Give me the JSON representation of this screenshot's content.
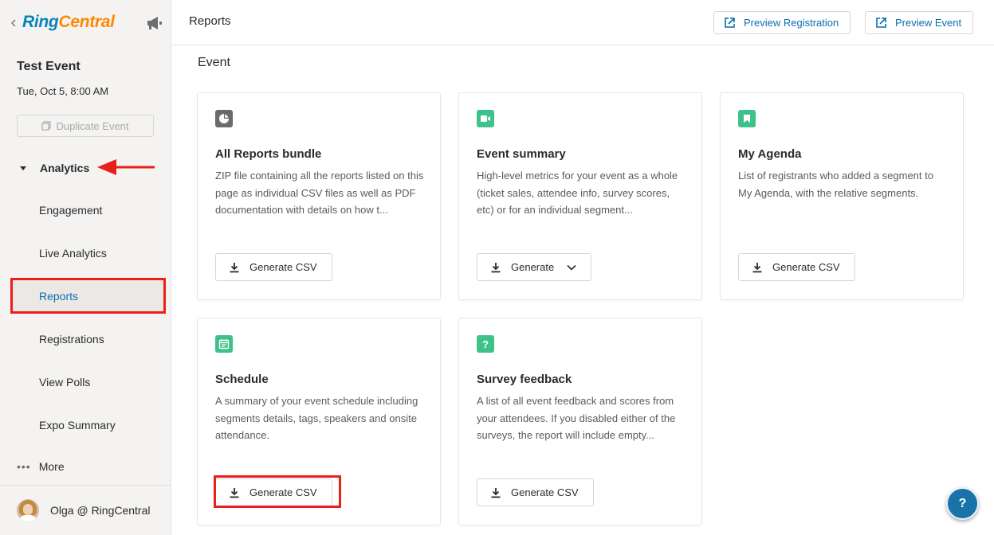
{
  "brand": {
    "name_part1": "Ring",
    "name_part2": "Central",
    "accent": "#0684bc",
    "accent2": "#ff8800"
  },
  "event": {
    "title": "Test Event",
    "date": "Tue, Oct 5, 8:00 AM",
    "duplicate_label": "Duplicate Event"
  },
  "nav": {
    "section_label": "Analytics",
    "items": [
      {
        "label": "Engagement",
        "active": false
      },
      {
        "label": "Live Analytics",
        "active": false
      },
      {
        "label": "Reports",
        "active": true
      },
      {
        "label": "Registrations",
        "active": false
      },
      {
        "label": "View Polls",
        "active": false
      },
      {
        "label": "Expo Summary",
        "active": false
      }
    ],
    "more_label": "More"
  },
  "user": {
    "name": "Olga @ RingCentral"
  },
  "header": {
    "title": "Reports",
    "preview_registration": "Preview Registration",
    "preview_event": "Preview Event"
  },
  "main": {
    "section_title": "Event",
    "cards": [
      {
        "title": "All Reports bundle",
        "desc": "ZIP file containing all the reports listed on this page as individual CSV files as well as PDF documentation with details on how t...",
        "button": "Generate CSV",
        "icon": "pie-chart-icon",
        "icon_color": "#6b6b6b"
      },
      {
        "title": "Event summary",
        "desc": "High-level metrics for your event as a whole (ticket sales, attendee info, survey scores, etc) or for an individual segment...",
        "button": "Generate",
        "icon": "video-camera-icon",
        "icon_color": "#3fc28a"
      },
      {
        "title": "My Agenda",
        "desc": "List of registrants who added a segment to My Agenda, with the relative segments.",
        "button": "Generate CSV",
        "icon": "bookmark-icon",
        "icon_color": "#3fc28a"
      },
      {
        "title": "Schedule",
        "desc": "A summary of your event schedule including segments details, tags, speakers and onsite attendance.",
        "button": "Generate CSV",
        "icon": "calendar-icon",
        "icon_color": "#3fc28a"
      },
      {
        "title": "Survey feedback",
        "desc": "A list of all event feedback and scores from your attendees. If you disabled either of the surveys, the report will include empty...",
        "button": "Generate CSV",
        "icon": "question-icon",
        "icon_color": "#3fc28a"
      }
    ]
  },
  "help": {
    "label": "?"
  }
}
